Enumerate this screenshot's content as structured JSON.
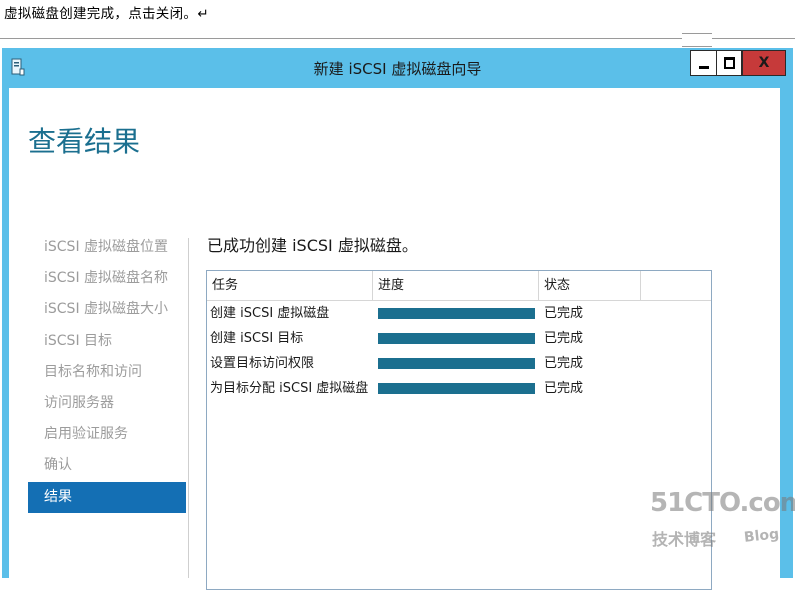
{
  "document": {
    "caption": "虚拟磁盘创建完成，点击关闭。↵"
  },
  "window": {
    "title": "新建 iSCSI 虚拟磁盘向导",
    "close_label": "X"
  },
  "page": {
    "title": "查看结果"
  },
  "nav": {
    "items": [
      {
        "label": "iSCSI 虚拟磁盘位置",
        "active": false
      },
      {
        "label": "iSCSI 虚拟磁盘名称",
        "active": false
      },
      {
        "label": "iSCSI 虚拟磁盘大小",
        "active": false
      },
      {
        "label": "iSCSI 目标",
        "active": false
      },
      {
        "label": "目标名称和访问",
        "active": false
      },
      {
        "label": "访问服务器",
        "active": false
      },
      {
        "label": "启用验证服务",
        "active": false
      },
      {
        "label": "确认",
        "active": false
      },
      {
        "label": "结果",
        "active": true
      }
    ]
  },
  "results": {
    "heading": "已成功创建 iSCSI 虚拟磁盘。",
    "columns": [
      "任务",
      "进度",
      "状态"
    ],
    "rows": [
      {
        "task": "创建 iSCSI 虚拟磁盘",
        "progress": 1.0,
        "status": "已完成"
      },
      {
        "task": "创建 iSCSI 目标",
        "progress": 1.0,
        "status": "已完成"
      },
      {
        "task": "设置目标访问权限",
        "progress": 1.0,
        "status": "已完成"
      },
      {
        "task": "为目标分配 iSCSI 虚拟磁盘",
        "progress": 1.0,
        "status": "已完成"
      }
    ]
  },
  "watermark": {
    "logo": "51CTO.com",
    "sub": "技术博客",
    "blog": "Blog"
  },
  "colors": {
    "titlebar": "#5bbfe9",
    "accent": "#1b6f8f",
    "nav_active": "#146fb4",
    "close_button": "#c63a3a"
  }
}
